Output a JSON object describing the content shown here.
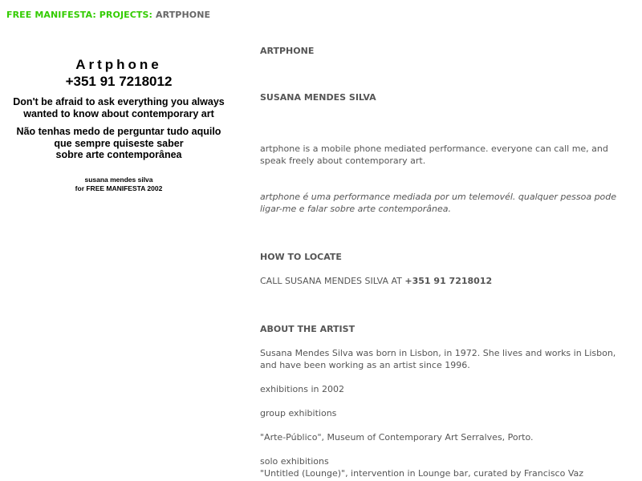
{
  "breadcrumb": {
    "link1": "FREE MANIFESTA:",
    "link2": "PROJECTS:",
    "current": "ARTPHONE"
  },
  "poster": {
    "title": "Artphone",
    "phone": "+351 91 7218012",
    "english_line1": "Don't be afraid to ask everything you always",
    "english_line2": "wanted to know about contemporary art",
    "portuguese_line1": "Não tenhas medo de perguntar tudo aquilo",
    "portuguese_line2": "que sempre quiseste saber",
    "portuguese_line3": "sobre arte contemporânea",
    "credit_line1": "susana mendes silva",
    "credit_line2": "for FREE MANIFESTA 2002"
  },
  "main": {
    "title": "ARTPHONE",
    "artist": "SUSANA MENDES SILVA",
    "desc_en": "artphone is a mobile phone mediated performance. everyone can call me, and speak freely about contemporary art.",
    "desc_pt": "artphone é uma performance mediada por um telemovél. qualquer pessoa pode ligar-me e falar sobre arte contemporânea.",
    "locate_heading": "HOW TO LOCATE",
    "locate_text": "CALL SUSANA MENDES SILVA AT ",
    "locate_phone": "+351 91 7218012",
    "about_heading": "ABOUT THE ARTIST",
    "about_text": "Susana Mendes Silva was born in Lisbon, in 1972. She lives and works in Lisbon, and have been working as an artist since 1996.",
    "exhibitions_year": "exhibitions in 2002",
    "group_label": "group exhibitions",
    "group_item": "\"Arte-Público\", Museum of Contemporary Art Serralves, Porto.",
    "solo_label": "solo exhibitions",
    "solo_item": "\"Untitled (Lounge)\", intervention in Lounge bar, curated by Francisco Vaz"
  },
  "colors": {
    "link": "#33cc00",
    "text": "#555555"
  }
}
